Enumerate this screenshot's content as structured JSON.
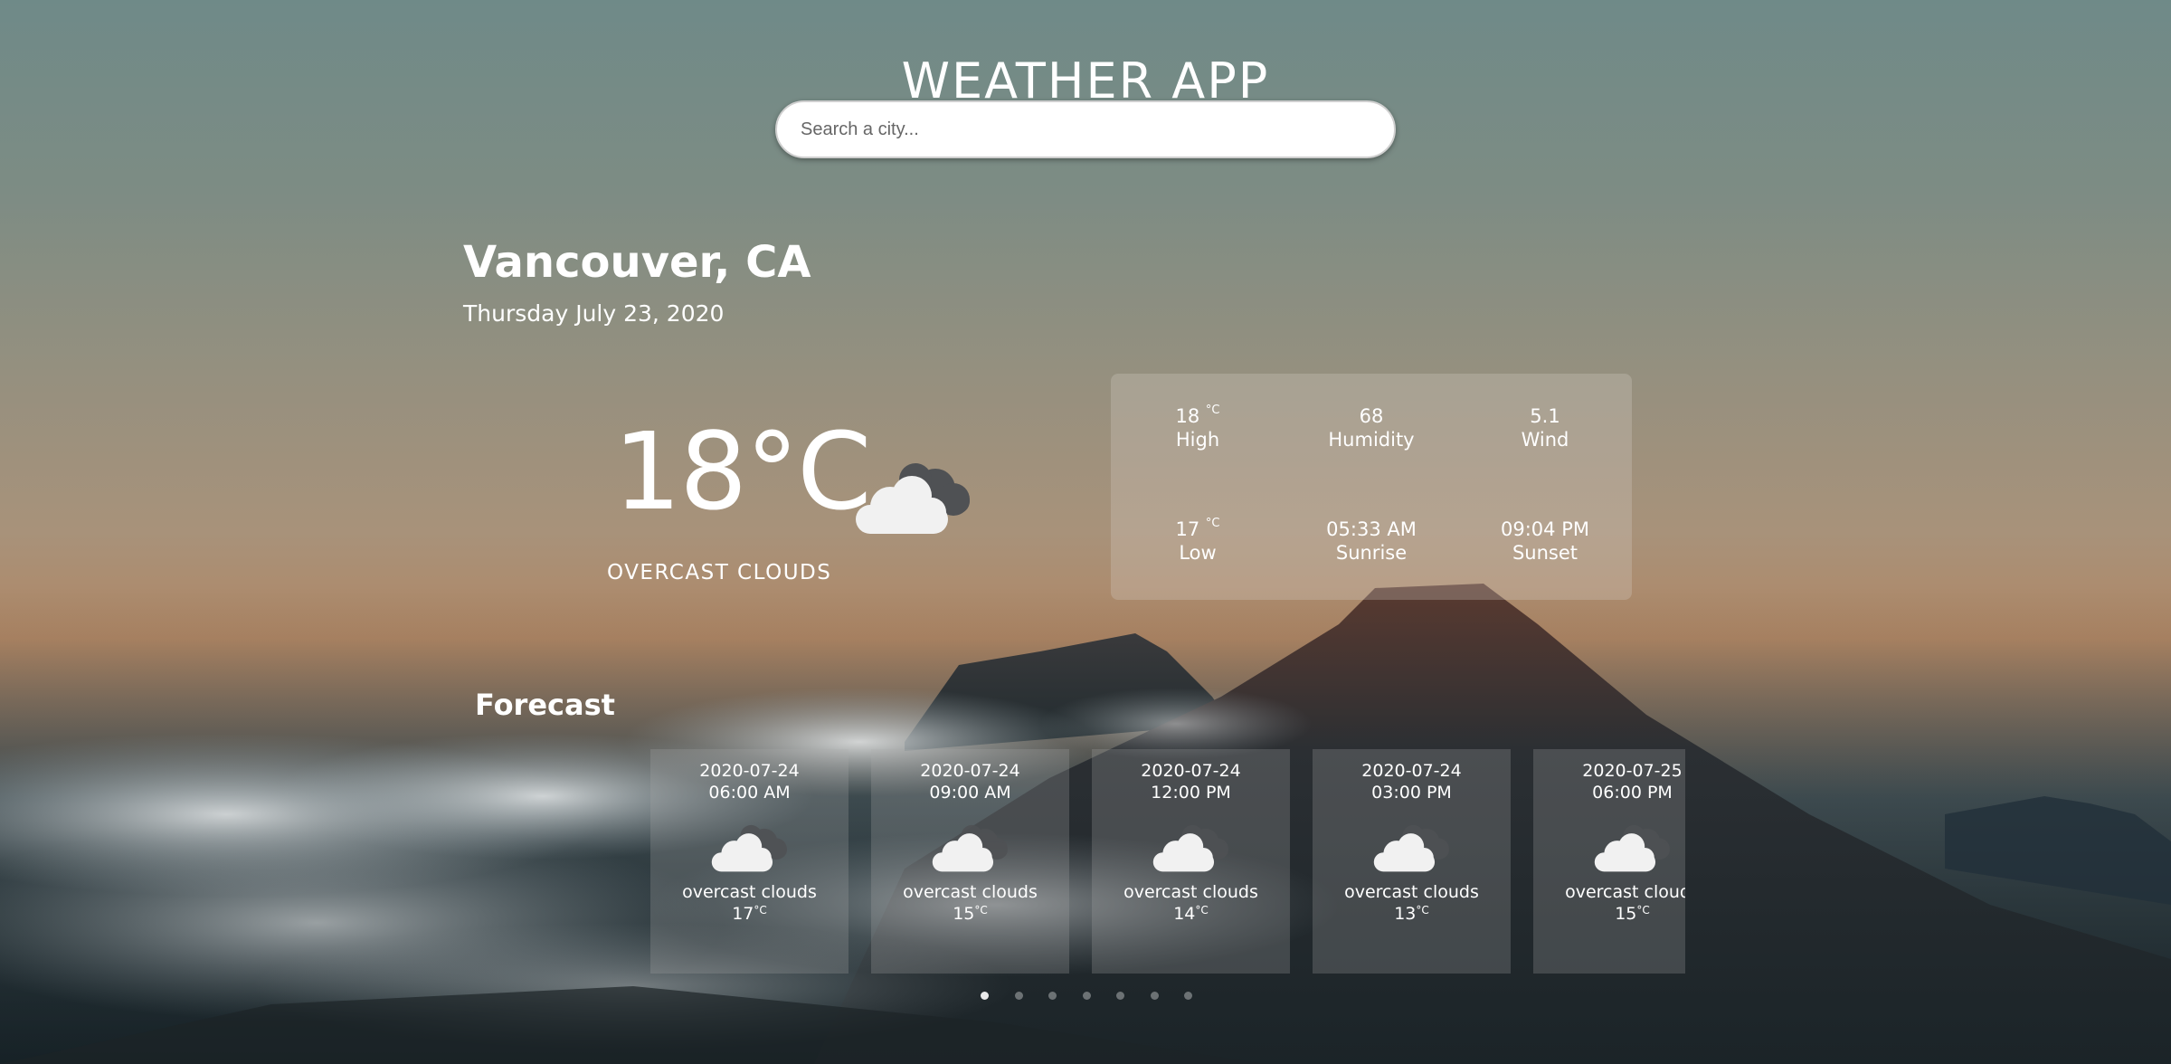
{
  "app": {
    "title": "WEATHER APP"
  },
  "search": {
    "placeholder": "Search a city..."
  },
  "current": {
    "city": "Vancouver, CA",
    "date": "Thursday July 23, 2020",
    "temp": "18",
    "unit": "°C",
    "description": "OVERCAST CLOUDS",
    "icon": "cloud-icon"
  },
  "details": {
    "high_value": "18",
    "high_unit": "°C",
    "high_label": "High",
    "humidity_value": "68",
    "humidity_label": "Humidity",
    "wind_value": "5.1",
    "wind_label": "Wind",
    "low_value": "17",
    "low_unit": "°C",
    "low_label": "Low",
    "sunrise_value": "05:33 AM",
    "sunrise_label": "Sunrise",
    "sunset_value": "09:04 PM",
    "sunset_label": "Sunset"
  },
  "forecast": {
    "title": "Forecast",
    "items": [
      {
        "date": "2020-07-24",
        "time": "06:00 AM",
        "desc": "overcast clouds",
        "temp": "17",
        "unit": "°C"
      },
      {
        "date": "2020-07-24",
        "time": "09:00 AM",
        "desc": "overcast clouds",
        "temp": "15",
        "unit": "°C"
      },
      {
        "date": "2020-07-24",
        "time": "12:00 PM",
        "desc": "overcast clouds",
        "temp": "14",
        "unit": "°C"
      },
      {
        "date": "2020-07-24",
        "time": "03:00 PM",
        "desc": "overcast clouds",
        "temp": "13",
        "unit": "°C"
      },
      {
        "date": "2020-07-25",
        "time": "06:00 PM",
        "desc": "overcast clouds",
        "temp": "15",
        "unit": "°C"
      }
    ],
    "pages": 7,
    "active_page": 1
  },
  "colors": {
    "panel": "#d7d0c8",
    "text": "#ffffff",
    "cloud_front": "#f0f0f0",
    "cloud_back": "#555555"
  }
}
